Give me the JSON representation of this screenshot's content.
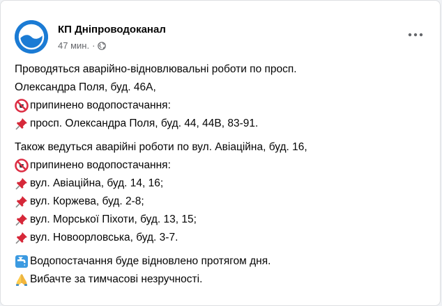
{
  "post": {
    "page_name": "КП Дніпроводоканал",
    "time": "47 мин.",
    "dot": "·",
    "paragraph1": {
      "line1": "Проводяться аварійно-відновлювальні роботи по просп.",
      "line2": "Олександра Поля, буд. 46А,",
      "line3": "припинено водопостачання:",
      "line4": "просп. Олександра Поля, буд. 44, 44В, 83-91."
    },
    "paragraph2": {
      "line1": "Також ведуться аварійні роботи по вул. Авіаційна, буд. 16,",
      "line2": "припинено водопостачання:",
      "line3": "вул. Авіаційна, буд. 14, 16;",
      "line4": "вул. Коржева, буд. 2-8;",
      "line5": "вул. Морської Піхоти, буд. 13, 15;",
      "line6": "вул. Новоорловська, буд. 3-7."
    },
    "paragraph3": {
      "line1": "Водопостачання буде відновлено протягом дня.",
      "line2": "Вибачте за тимчасові незручності."
    }
  },
  "icons": {
    "avatar": "water-drop-logo-icon",
    "visibility": "globe-icon",
    "menu": "more-horizontal-icon",
    "no_water": "no-entry-sign-icon",
    "pin": "pushpin-icon",
    "restored": "faucet-icon",
    "sorry": "folded-hands-icon"
  },
  "colors": {
    "brand_blue": "#1b7bd4",
    "text": "#050505",
    "secondary_text": "#65676b",
    "pin_red": "#d62839",
    "no_entry_red": "#dd2e44"
  }
}
